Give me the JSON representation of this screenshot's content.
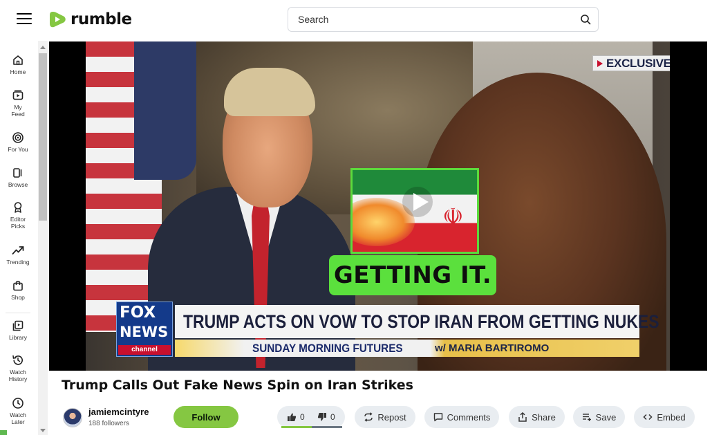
{
  "header": {
    "logo_text": "rumble",
    "brand_color": "#85c742",
    "search_placeholder": "Search"
  },
  "sidebar": {
    "items": [
      {
        "label": "Home",
        "icon": "home-icon"
      },
      {
        "label": "My Feed",
        "icon": "feed-icon"
      },
      {
        "label": "For You",
        "icon": "target-icon"
      },
      {
        "label": "Browse",
        "icon": "browse-icon"
      },
      {
        "label": "Editor Picks",
        "icon": "ribbon-icon"
      },
      {
        "label": "Trending",
        "icon": "trending-icon"
      },
      {
        "label": "Shop",
        "icon": "shop-icon"
      },
      {
        "label": "Library",
        "icon": "library-icon"
      },
      {
        "label": "Watch History",
        "icon": "history-icon"
      },
      {
        "label": "Watch Later",
        "icon": "clock-icon"
      }
    ]
  },
  "video": {
    "exclusive_badge": "EXCLUSIVE",
    "overlay_caption": "GETTING IT.",
    "network_top": "FOX",
    "network_mid": "NEWS",
    "network_bottom": "channel",
    "headline": "TRUMP ACTS ON VOW TO STOP IRAN FROM GETTING NUKES",
    "show_name": "SUNDAY MORNING FUTURES",
    "show_host": "w/ MARIA BARTIROMO"
  },
  "title": "Trump Calls Out Fake News Spin on Iran Strikes",
  "channel": {
    "name": "jamiemcintyre",
    "followers": "188 followers",
    "follow_label": "Follow"
  },
  "actions": {
    "likes": "0",
    "dislikes": "0",
    "repost": "Repost",
    "comments": "Comments",
    "share": "Share",
    "save": "Save",
    "embed": "Embed"
  }
}
